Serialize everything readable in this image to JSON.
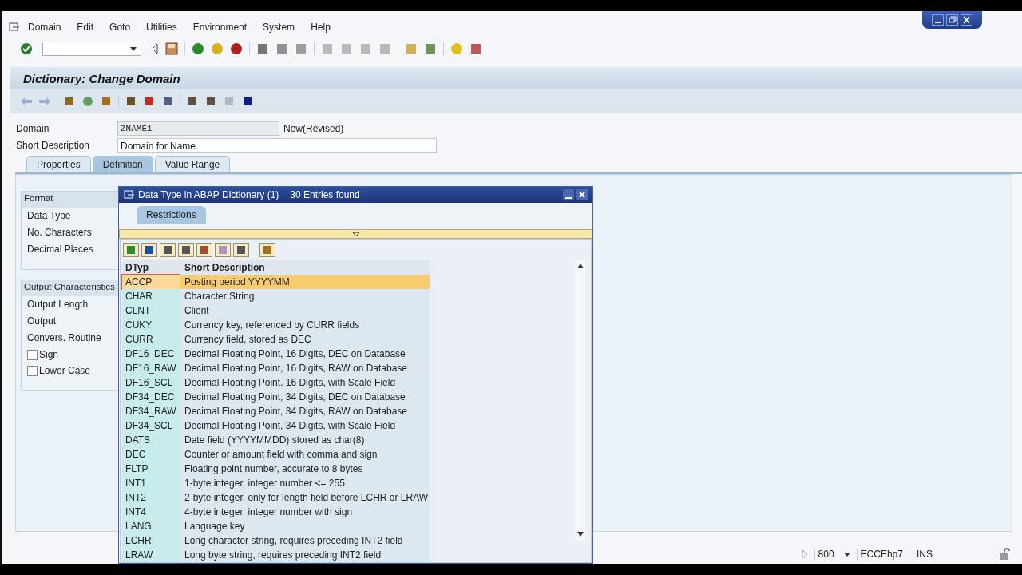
{
  "menu": [
    "Domain",
    "Edit",
    "Goto",
    "Utilities",
    "Environment",
    "System",
    "Help"
  ],
  "screen_title": "Dictionary: Change Domain",
  "header_fields": [
    {
      "label": "Domain",
      "value": "ZNAME1",
      "status": "New(Revised)",
      "readonly": true
    },
    {
      "label": "Short Description",
      "value": "Domain for Name",
      "readonly": false
    }
  ],
  "tabs": [
    {
      "label": "Properties",
      "selected": false
    },
    {
      "label": "Definition",
      "selected": true
    },
    {
      "label": "Value Range",
      "selected": false
    }
  ],
  "groups": [
    {
      "title": "Format",
      "fields": [
        "Data Type",
        "No. Characters",
        "Decimal Places"
      ]
    },
    {
      "title": "Output Characteristics",
      "fields": [
        "Output Length",
        "Output",
        "Convers. Routine"
      ],
      "checkboxes": [
        {
          "label": "Sign",
          "checked": false
        },
        {
          "label": "Lower Case",
          "checked": false
        }
      ]
    }
  ],
  "popup": {
    "title": "Data Type in ABAP Dictionary (1)",
    "count": "30 Entries found",
    "tab": "Restrictions",
    "columns": [
      "DTyp",
      "Short Description"
    ],
    "rows": [
      {
        "code": "ACCP",
        "text": "Posting period YYYYMM",
        "selected": true
      },
      {
        "code": "CHAR",
        "text": "Character String",
        "selected": false
      },
      {
        "code": "CLNT",
        "text": "Client",
        "selected": false
      },
      {
        "code": "CUKY",
        "text": "Currency key, referenced by CURR fields",
        "selected": false
      },
      {
        "code": "CURR",
        "text": "Currency field, stored as DEC",
        "selected": false
      },
      {
        "code": "DF16_DEC",
        "text": "Decimal Floating Point, 16 Digits, DEC on Database",
        "selected": false
      },
      {
        "code": "DF16_RAW",
        "text": "Decimal Floating Point, 16 Digits,  RAW on Database",
        "selected": false
      },
      {
        "code": "DF16_SCL",
        "text": "Decimal Floating Point. 16 Digits, with Scale Field",
        "selected": false
      },
      {
        "code": "DF34_DEC",
        "text": "Decimal Floating Point, 34 Digits, DEC on Database",
        "selected": false
      },
      {
        "code": "DF34_RAW",
        "text": "Decimal Floating Point, 34 Digits, RAW on Database",
        "selected": false
      },
      {
        "code": "DF34_SCL",
        "text": "Decimal Floating Point, 34 Digits, with Scale Field",
        "selected": false
      },
      {
        "code": "DATS",
        "text": "Date field (YYYYMMDD) stored as char(8)",
        "selected": false
      },
      {
        "code": "DEC",
        "text": "Counter or amount field with comma and sign",
        "selected": false
      },
      {
        "code": "FLTP",
        "text": "Floating point number, accurate to 8 bytes",
        "selected": false
      },
      {
        "code": "INT1",
        "text": "1-byte integer, integer number <= 255",
        "selected": false
      },
      {
        "code": "INT2",
        "text": "2-byte integer, only for length field before LCHR or LRAW",
        "selected": false
      },
      {
        "code": "INT4",
        "text": "4-byte integer, integer number with sign",
        "selected": false
      },
      {
        "code": "LANG",
        "text": "Language key",
        "selected": false
      },
      {
        "code": "LCHR",
        "text": "Long character string, requires preceding INT2 field",
        "selected": false
      },
      {
        "code": "LRAW",
        "text": "Long byte string, requires preceding INT2 field",
        "selected": false
      }
    ]
  },
  "status_bar": {
    "client": "800",
    "system": "ECCEhp7",
    "mode": "INS"
  }
}
